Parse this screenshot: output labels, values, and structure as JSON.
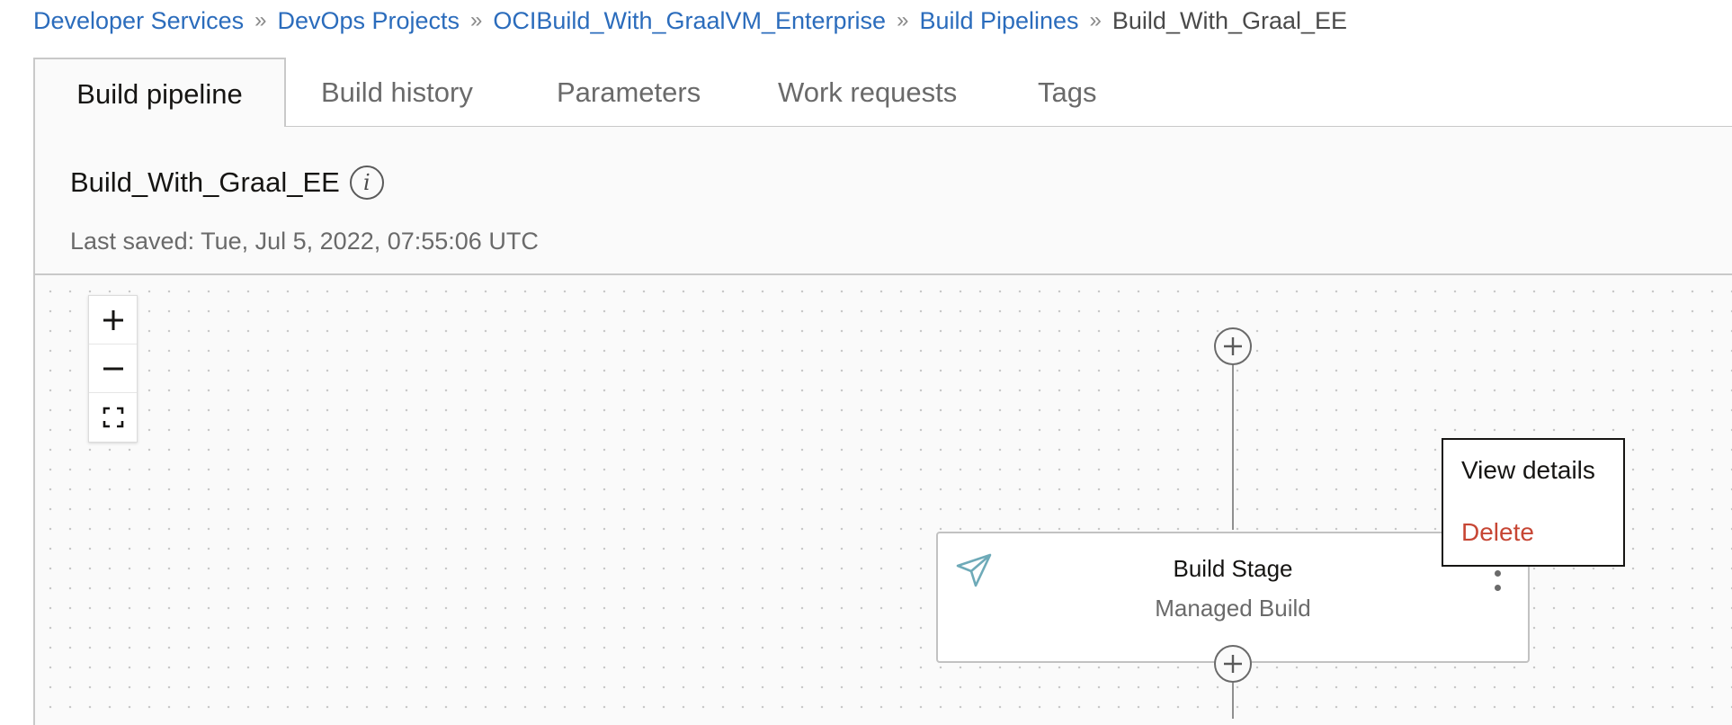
{
  "breadcrumb": {
    "items": [
      "Developer Services",
      "DevOps Projects",
      "OCIBuild_With_GraalVM_Enterprise",
      "Build Pipelines"
    ],
    "separator": "»",
    "current": "Build_With_Graal_EE"
  },
  "tabs": [
    {
      "label": "Build pipeline",
      "active": true
    },
    {
      "label": "Build history",
      "active": false
    },
    {
      "label": "Parameters",
      "active": false
    },
    {
      "label": "Work requests",
      "active": false
    },
    {
      "label": "Tags",
      "active": false
    }
  ],
  "pipeline": {
    "name": "Build_With_Graal_EE",
    "info_icon": "info-icon",
    "last_saved": "Last saved: Tue, Jul 5, 2022, 07:55:06 UTC"
  },
  "zoom_controls": {
    "icons": [
      "plus-icon",
      "minus-icon",
      "fit-screen-icon"
    ]
  },
  "stage": {
    "name": "Build Stage",
    "type": "Managed Build",
    "icon": "send-icon",
    "menu_icon": "kebab-icon"
  },
  "context_menu": {
    "items": [
      "View details",
      "Delete"
    ],
    "delete_color": "#c74634"
  },
  "colors": {
    "link": "#2b6cbc",
    "canvas": "#fafafa",
    "stage_icon": "#6eaab8"
  }
}
